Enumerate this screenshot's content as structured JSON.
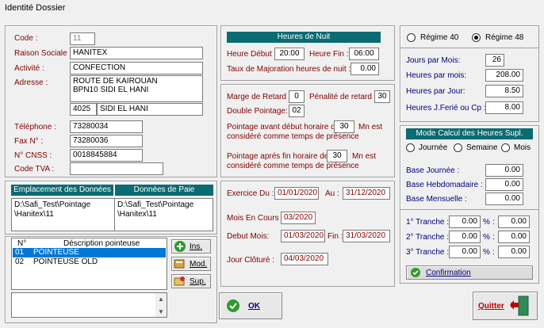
{
  "window": {
    "title": "Identité Dossier"
  },
  "company": {
    "code_label": "Code :",
    "code_value": "11",
    "raison_label": "Raison Sociale :",
    "raison_value": "HANITEX",
    "activite_label": "Activité :",
    "activite_value": "CONFECTION",
    "adresse_label": "Adresse :",
    "adresse_line1": "ROUTE DE KAIROUAN",
    "adresse_line2": "BPN10 SIDI EL HANI",
    "postal_code": "4025",
    "city": "SIDI EL HANI",
    "telephone_label": "Téléphone :",
    "telephone_value": "73280034",
    "fax_label": "Fax N° :",
    "fax_value": "73280036",
    "cnss_label": "N° CNSS :",
    "cnss_value": "0018845884",
    "tva_label": "Code TVA :",
    "tva_value": ""
  },
  "data_paths": {
    "emplacement_header": "Emplacement des Données",
    "paie_header": "Données de Paie",
    "emplacement_line1": "D:\\Safi_Test\\Pointage",
    "emplacement_line2": "\\Hanitex\\11",
    "paie_line1": "D:\\Safi_Test\\Pointage",
    "paie_line2": "\\Hanitex\\11"
  },
  "pointeuse": {
    "col_num": "N°",
    "col_desc": "Déscription pointeuse",
    "rows": [
      {
        "num": "01",
        "desc": "POINTEUSE"
      },
      {
        "num": "02",
        "desc": "POINTEUSE OLD"
      }
    ],
    "ins_label": "Ins.",
    "mod_label": "Mod.",
    "sup_label": "Sup."
  },
  "nuit": {
    "header": "Heures de Nuit",
    "debut_label": "Heure Début :",
    "debut_value": "20:00",
    "fin_label": "Heure Fin :",
    "fin_value": "06:00",
    "taux_label": "Taux de Majoration heures de nuit :",
    "taux_value": "0.00"
  },
  "retard": {
    "marge_label": "Marge de Retard :",
    "marge_value": "0",
    "penalite_label": "Pénalité de retard :",
    "penalite_value": "30",
    "double_label": "Double Pointage:",
    "double_value": "02",
    "avant_label1": "Pointage avant début horaire de",
    "avant_value": "30",
    "avant_unit": "Mn est",
    "avant_label2": "considéré comme temps de présence",
    "apres_label1": "Pointage aprés fin horaire de",
    "apres_value": "30",
    "apres_unit": "Mn est",
    "apres_label2": "considéré comme temps de présence"
  },
  "exercice": {
    "label": "Exercice  Du :",
    "du_value": "01/01/2020",
    "au_label": "Au :",
    "au_value": "31/12/2020",
    "mois_label": "Mois En Cours :",
    "mois_value": "03/2020",
    "debut_label": "Debut Mois:",
    "debut_value": "01/03/2020",
    "fin_label": "Fin :",
    "fin_value": "31/03/2020",
    "cloture_label": "Jour Clôturé :",
    "cloture_value": "04/03/2020"
  },
  "regime": {
    "r40_label": "Régime 40",
    "r48_label": "Régime 48",
    "selected": "48",
    "jours_label": "Jours par Mois:",
    "jours_value": "26",
    "hmois_label": "Heures par mois:",
    "hmois_value": "208.00",
    "hjour_label": "Heures par Jour:",
    "hjour_value": "8.50",
    "hferie_label": "Heures  J.Ferié ou Cp :",
    "hferie_value": "8.00"
  },
  "supl": {
    "header": "Mode Calcul des Heures Supl.",
    "opt_journee": "Journée",
    "opt_semaine": "Semaine",
    "opt_mois": "Mois",
    "base_j_label": "Base Journée :",
    "base_j_value": "0.00",
    "base_h_label": "Base Hebdomadaire :",
    "base_h_value": "0.00",
    "base_m_label": "Base Mensuelle :",
    "base_m_value": "0.00",
    "t1_label": "1° Tranche :",
    "t1_a": "0.00",
    "t1_b": "0.00",
    "t2_label": "2° Tranche :",
    "t2_a": "0.00",
    "t2_b": "0.00",
    "t3_label": "3° Tranche :",
    "t3_a": "0.00",
    "t3_b": "0.00",
    "pct": "%",
    "confirm_label": "Confirmation"
  },
  "buttons": {
    "ok_label": "OK",
    "quit_label": "Quitter"
  }
}
